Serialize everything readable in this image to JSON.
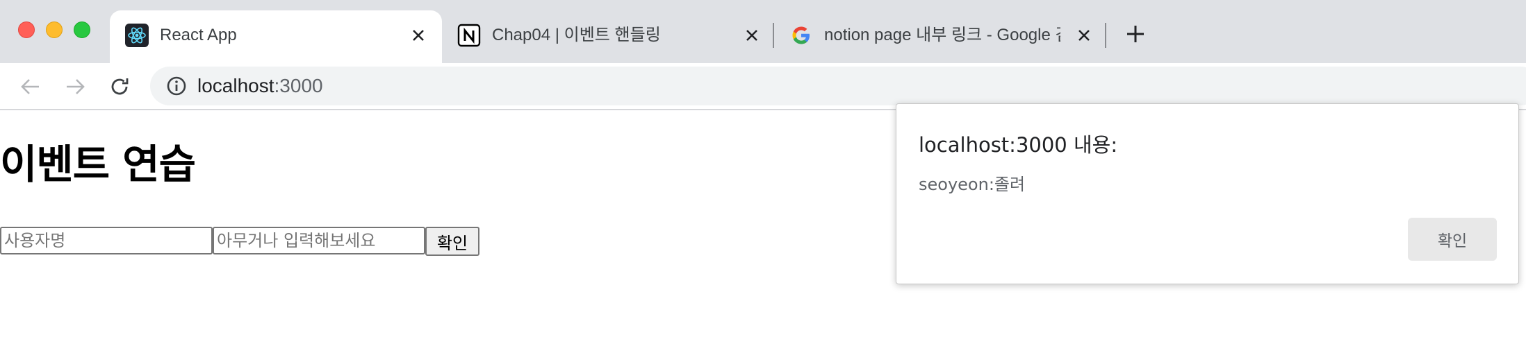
{
  "window": {
    "controls": [
      "close",
      "minimize",
      "maximize"
    ]
  },
  "tabs": [
    {
      "title": "React App",
      "favicon": "react-icon",
      "active": true
    },
    {
      "title": "Chap04 | 이벤트 핸들링",
      "favicon": "notion-icon",
      "active": false
    },
    {
      "title": "notion page 내부 링크 - Google 검색",
      "favicon": "google-icon",
      "active": false
    }
  ],
  "toolbar": {
    "back_icon": "arrow-left-icon",
    "forward_icon": "arrow-right-icon",
    "reload_icon": "reload-icon",
    "url_host": "localhost",
    "url_port": ":3000"
  },
  "page": {
    "heading": "이벤트 연습",
    "username_placeholder": "사용자명",
    "message_placeholder": "아무거나 입력해보세요",
    "confirm_label": "확인"
  },
  "alert": {
    "title": "localhost:3000 내용:",
    "message": "seoyeon:졸려",
    "ok_label": "확인"
  },
  "colors": {
    "tabstrip_bg": "#dfe1e5",
    "omnibox_bg": "#f1f3f4",
    "react_blue": "#61dafb"
  }
}
